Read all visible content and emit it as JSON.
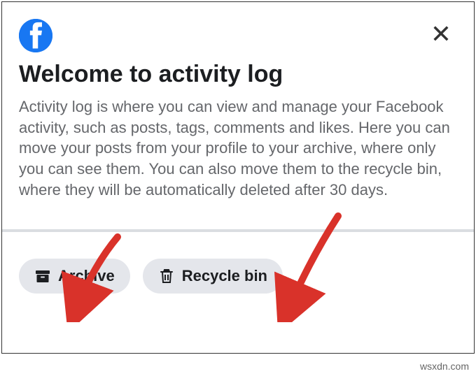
{
  "header": {
    "logo_name": "facebook-logo"
  },
  "title": "Welcome to activity log",
  "description": "Activity log is where you can view and manage your Facebook activity, such as posts, tags, comments and likes. Here you can move your posts from your profile to your archive, where only you can see them. You can also move them to the recycle bin, where they will be automatically deleted after 30 days.",
  "buttons": {
    "archive": "Archive",
    "recycle_bin": "Recycle bin"
  },
  "watermark": "wsxdn.com"
}
